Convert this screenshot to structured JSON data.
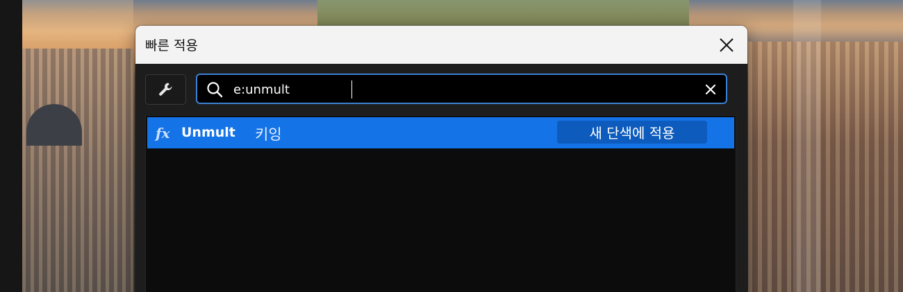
{
  "dialog": {
    "title": "빠른 적용",
    "close_icon": "close-icon"
  },
  "toolbar": {
    "settings_icon": "wrench-icon"
  },
  "search": {
    "value": "e:unmult",
    "icon": "search-icon",
    "clear_icon": "clear-icon",
    "accent": "#3b82d6"
  },
  "results": [
    {
      "icon": "fx-icon",
      "icon_label": "fx",
      "name": "Unmult",
      "category": "키잉",
      "action_label": "새 단색에 적용",
      "selected": true,
      "highlight_color": "#1473e6"
    }
  ]
}
